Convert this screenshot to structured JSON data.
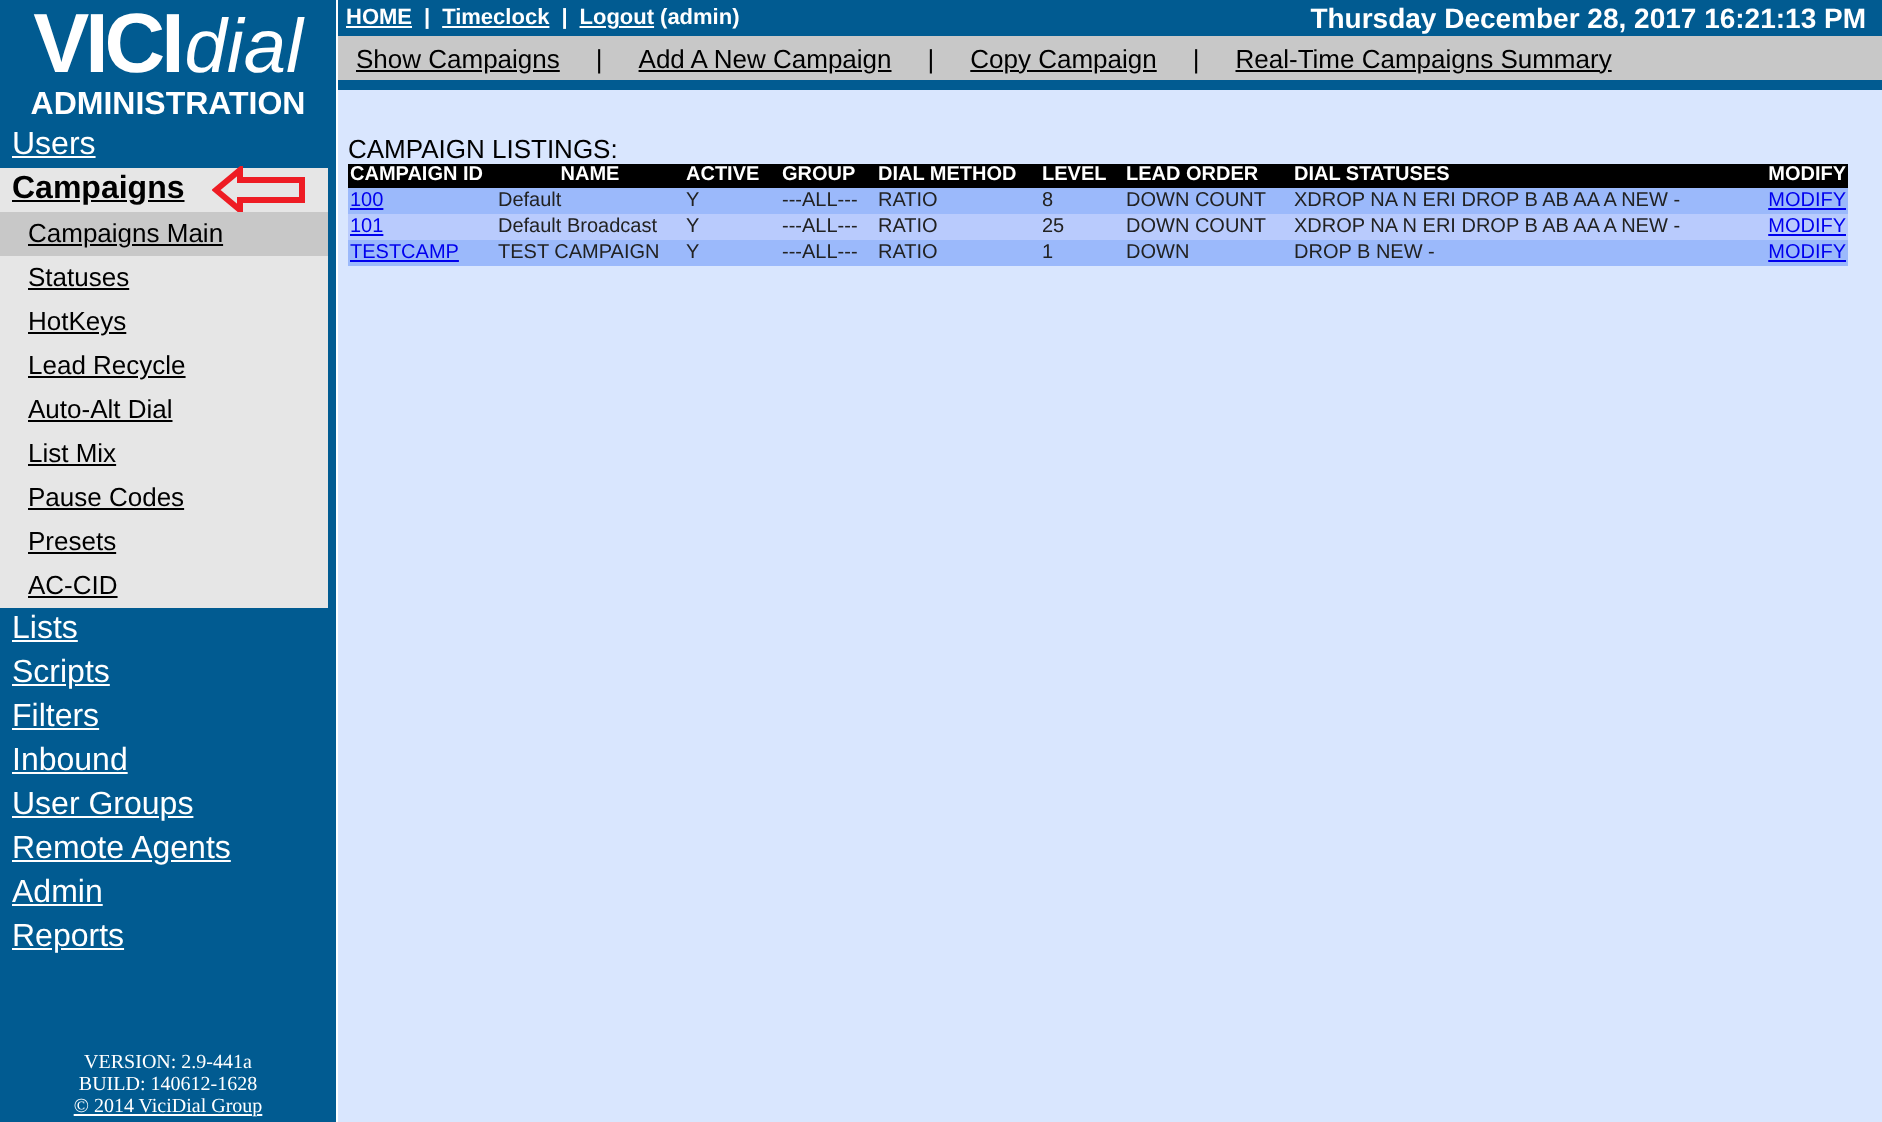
{
  "logo": {
    "brand_left": "VICI",
    "brand_right": "dial",
    "subtitle": "ADMINISTRATION"
  },
  "sidebar": {
    "items": [
      {
        "label": "Users",
        "selected": false
      },
      {
        "label": "Campaigns",
        "selected": true,
        "children": [
          {
            "label": "Campaigns Main",
            "selected": true
          },
          {
            "label": "Statuses",
            "selected": false
          },
          {
            "label": "HotKeys",
            "selected": false
          },
          {
            "label": "Lead Recycle",
            "selected": false
          },
          {
            "label": "Auto-Alt Dial",
            "selected": false
          },
          {
            "label": "List Mix",
            "selected": false
          },
          {
            "label": "Pause Codes",
            "selected": false
          },
          {
            "label": "Presets",
            "selected": false
          },
          {
            "label": "AC-CID",
            "selected": false
          }
        ]
      },
      {
        "label": "Lists",
        "selected": false
      },
      {
        "label": "Scripts",
        "selected": false
      },
      {
        "label": "Filters",
        "selected": false
      },
      {
        "label": "Inbound",
        "selected": false
      },
      {
        "label": "User Groups",
        "selected": false
      },
      {
        "label": "Remote Agents",
        "selected": false
      },
      {
        "label": "Admin",
        "selected": false
      },
      {
        "label": "Reports",
        "selected": false
      }
    ],
    "footer": {
      "version": "VERSION: 2.9-441a",
      "build": "BUILD: 140612-1628",
      "copyright": "© 2014 ViciDial Group"
    }
  },
  "top_bar": {
    "links": [
      "HOME",
      "Timeclock",
      "Logout"
    ],
    "separators": [
      "|",
      "|"
    ],
    "user": "(admin)",
    "datetime": "Thursday December 28, 2017 16:21:13 PM"
  },
  "sub_nav": {
    "links": [
      "Show Campaigns",
      "Add A New Campaign",
      "Copy Campaign",
      "Real-Time Campaigns Summary"
    ],
    "separators": [
      "|",
      "|",
      "|"
    ]
  },
  "listing": {
    "title": "CAMPAIGN LISTINGS:",
    "columns": [
      "CAMPAIGN ID",
      "NAME",
      "ACTIVE",
      "GROUP",
      "DIAL METHOD",
      "LEVEL",
      "LEAD ORDER",
      "DIAL STATUSES",
      "MODIFY"
    ],
    "rows": [
      [
        "100",
        "Default",
        "Y",
        "---ALL---",
        "RATIO",
        "8",
        "DOWN COUNT",
        "XDROP NA N ERI DROP B AB AA A NEW -",
        "MODIFY"
      ],
      [
        "101",
        "Default Broadcast",
        "Y",
        "---ALL---",
        "RATIO",
        "25",
        "DOWN COUNT",
        "XDROP NA N ERI DROP B AB AA A NEW -",
        "MODIFY"
      ],
      [
        "TESTCAMP",
        "TEST CAMPAIGN",
        "Y",
        "---ALL---",
        "RATIO",
        "1",
        "DOWN",
        "DROP B NEW -",
        "MODIFY"
      ]
    ]
  }
}
